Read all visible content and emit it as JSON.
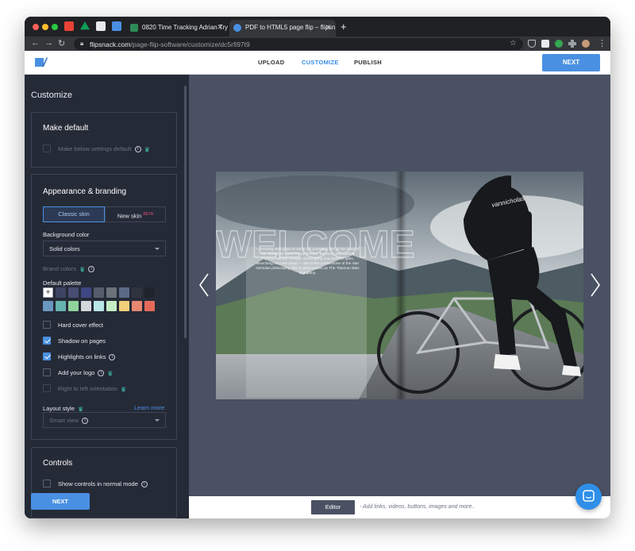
{
  "browser": {
    "tabs": [
      {
        "label": "0820 Time Tracking Adrian Try",
        "favicon_color": "#2e8b57"
      },
      {
        "label": "PDF to HTML5 page flip – flipsn",
        "favicon_color": "#4a90e2"
      }
    ],
    "url_domain": "flipsnack.com",
    "url_path": "/page-flip-software/customize/dc5rfi97t9",
    "pinned_icons": [
      "gmail-icon",
      "drive-icon",
      "flip-icon",
      "docs-icon"
    ]
  },
  "header": {
    "steps": [
      "UPLOAD",
      "CUSTOMIZE",
      "PUBLISH"
    ],
    "active_step": "CUSTOMIZE",
    "next_label": "NEXT"
  },
  "sidebar": {
    "title": "Customize",
    "make_default": {
      "heading": "Make default",
      "checkbox_label": "Make below settings default"
    },
    "appearance": {
      "heading": "Appearance & branding",
      "skin_classic": "Classic skin",
      "skin_new": "New skin",
      "skin_new_badge": "BETA",
      "background_color_label": "Background color",
      "background_color_value": "Solid colors",
      "brand_colors_label": "Brand colors",
      "default_palette_label": "Default palette",
      "palette_row1": [
        "#ffffff",
        "#3d4463",
        "#474c72",
        "#3e4783",
        "#555c6b",
        "#6b7179",
        "#5c6a85",
        "#2e333e",
        "#1f232c"
      ],
      "palette_row2": [
        "#6a97c2",
        "#66b3b0",
        "#8fd39a",
        "#d4d7db",
        "#b8e6e6",
        "#c5ecc2",
        "#f0d07a",
        "#e7876f",
        "#e56a5a"
      ],
      "options": [
        {
          "label": "Hard cover effect",
          "checked": false,
          "info": false,
          "premium": false,
          "disabled": false
        },
        {
          "label": "Shadow on pages",
          "checked": true,
          "info": false,
          "premium": false,
          "disabled": false
        },
        {
          "label": "Highlights on links",
          "checked": true,
          "info": true,
          "premium": false,
          "disabled": false
        },
        {
          "label": "Add your logo",
          "checked": false,
          "info": true,
          "premium": true,
          "disabled": false
        },
        {
          "label": "Right to left orientation",
          "checked": false,
          "info": false,
          "premium": true,
          "disabled": true
        }
      ],
      "layout_style_label": "Layout style",
      "learn_more": "Learn more",
      "layout_style_value": "Smart view"
    },
    "controls": {
      "heading": "Controls",
      "checkbox_label": "Show controls in normal mode"
    },
    "next_label": "NEXT"
  },
  "preview": {
    "welcome_text": "WELCOME",
    "intro_paragraph": "— Finding new ways to solve old problems lies at the heart of our relentless quest for perfection. Because you cannot improve without change. Embodying new technologies, searching out new ideas — this is the cornerstone of the Van Nicholas philosophy, this is what makes us The Titanium Bike Company.",
    "jersey_text": "vannicholas"
  },
  "bottom_bar": {
    "editor_label": "Editor",
    "editor_hint": "- Add links, videos, buttons, images and more.."
  }
}
